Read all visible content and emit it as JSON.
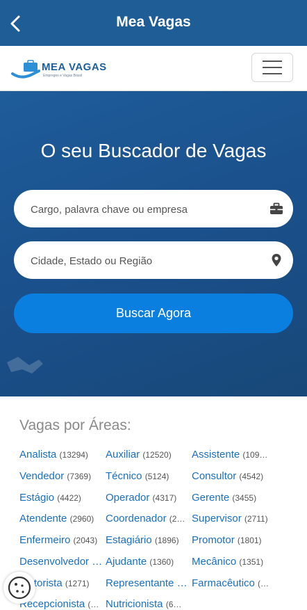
{
  "appbar": {
    "title": "Mea Vagas"
  },
  "brand": {
    "name": "MEA VAGAS",
    "tagline": "Empregos e Vagas Brasil"
  },
  "hero": {
    "heading": "O seu Buscador de Vagas",
    "job_placeholder": "Cargo, palavra chave ou empresa",
    "location_placeholder": "Cidade, Estado ou Região",
    "search_button": "Buscar Agora"
  },
  "areas": {
    "heading": "Vagas por Áreas:",
    "items": [
      {
        "name": "Analista",
        "count": "(13294)"
      },
      {
        "name": "Auxiliar",
        "count": "(12520)"
      },
      {
        "name": "Assistente",
        "count": "(109…"
      },
      {
        "name": "Vendedor",
        "count": "(7369)"
      },
      {
        "name": "Técnico",
        "count": "(5124)"
      },
      {
        "name": "Consultor",
        "count": "(4542)"
      },
      {
        "name": "Estágio",
        "count": "(4422)"
      },
      {
        "name": "Operador",
        "count": "(4317)"
      },
      {
        "name": "Gerente",
        "count": "(3455)"
      },
      {
        "name": "Atendente",
        "count": "(2960)"
      },
      {
        "name": "Coordenador",
        "count": "(2…"
      },
      {
        "name": "Supervisor",
        "count": "(2711)"
      },
      {
        "name": "Enfermeiro",
        "count": "(2043)"
      },
      {
        "name": "Estagiário",
        "count": "(1896)"
      },
      {
        "name": "Promotor",
        "count": "(1801)"
      },
      {
        "name": "Desenvolvedor …",
        "count": ""
      },
      {
        "name": "Ajudante",
        "count": "(1360)"
      },
      {
        "name": "Mecânico",
        "count": "(1351)"
      },
      {
        "name": "Motorista",
        "count": "(1271)"
      },
      {
        "name": "Representante …",
        "count": ""
      },
      {
        "name": "Farmacêutico",
        "count": "(…"
      },
      {
        "name": "Recepcionista",
        "count": "(…"
      },
      {
        "name": "Nutricionista",
        "count": "(6…"
      }
    ]
  }
}
